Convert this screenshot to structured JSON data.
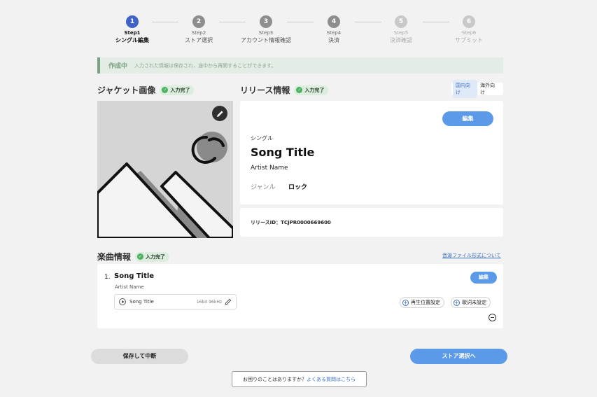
{
  "stepper": {
    "steps": [
      {
        "num": "1",
        "step": "Step1",
        "label": "シングル編集",
        "state": "active"
      },
      {
        "num": "2",
        "step": "Step2",
        "label": "ストア選択",
        "state": "pending"
      },
      {
        "num": "3",
        "step": "Step3",
        "label": "アカウント情報確認",
        "state": "pending"
      },
      {
        "num": "4",
        "step": "Step4",
        "label": "決済",
        "state": "pending"
      },
      {
        "num": "5",
        "step": "Step5",
        "label": "決済確認",
        "state": "future"
      },
      {
        "num": "6",
        "step": "Step6",
        "label": "サブミット",
        "state": "future"
      }
    ]
  },
  "banner": {
    "title": "作成中",
    "text": "入力された情報は保存され、途中から再開することができます。"
  },
  "jacket": {
    "heading": "ジャケット画像",
    "badge": "入力完了",
    "edit_icon": "pencil-icon"
  },
  "release": {
    "heading": "リリース情報",
    "badge": "入力完了",
    "region_domestic": "国内向け",
    "region_overseas": "海外向け",
    "edit_label": "編集",
    "type": "シングル",
    "title": "Song Title",
    "artist": "Artist Name",
    "genre_label": "ジャンル",
    "genre_value": "ロック",
    "release_id": "リリースID：TCJPR0000669600"
  },
  "tracks": {
    "heading": "楽曲情報",
    "badge": "入力完了",
    "format_link": "音源ファイル形式について",
    "items": [
      {
        "num": "1.",
        "title": "Song Title",
        "artist": "Artist Name",
        "edit_label": "編集",
        "file_name": "Song Title",
        "file_spec": "16bit 96kHz",
        "playback_label": "再生位置設定",
        "lyrics_label": "歌詞未設定"
      }
    ]
  },
  "footer": {
    "save_label": "保存して中断",
    "next_label": "ストア選択へ",
    "help_text": "お困りのことはありますか？",
    "help_link": "よくある質問はこちら"
  },
  "colors": {
    "accent": "#5b9ae8",
    "active_step": "#3f63c7",
    "complete_green": "#4caf62"
  }
}
